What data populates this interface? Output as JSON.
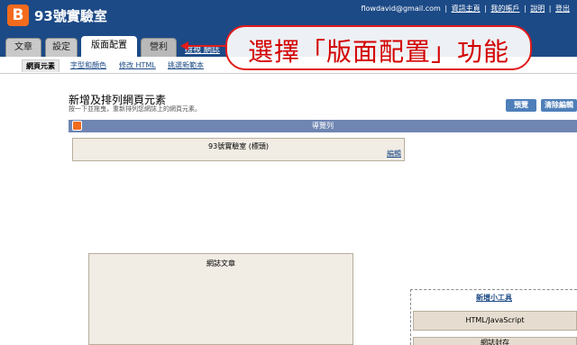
{
  "header": {
    "logo_glyph": "B",
    "blog_title": "93號實驗室",
    "email": "flowdavid@gmail.com",
    "links": [
      "資訊主頁",
      "我的帳戶",
      "說明",
      "登出"
    ],
    "separator": "|"
  },
  "tabs": {
    "posts": "文章",
    "settings": "設定",
    "layout": "版面配置",
    "monetize": "營利",
    "view_blog": "檢視 網誌"
  },
  "subtabs": {
    "page_elements": "網頁元素",
    "fonts_colors": "字型和顏色",
    "edit_html": "修改 HTML",
    "pick_template": "挑選新範本"
  },
  "annotation": {
    "text": "選擇「版面配置」功能"
  },
  "main": {
    "title": "新增及排列網頁元素",
    "description": "按一下並拖曳，重新排列您網誌上的網頁元素。",
    "preview_button": "預覽",
    "clear_button": "清除編輯"
  },
  "layout": {
    "navbar_label": "導覽列",
    "header_widget": "93號實驗室 (標頭)",
    "edit_link": "編輯",
    "posts_widget": "網誌文章",
    "add_gadget": "新增小工具",
    "html_widget": "HTML/JavaScript",
    "cut_widget": "網誌封存"
  },
  "colors": {
    "brand_blue": "#1c4a86",
    "accent_orange": "#f26b1d",
    "annotation_red": "#e21b1b",
    "widget_beige": "#f1ece4"
  }
}
